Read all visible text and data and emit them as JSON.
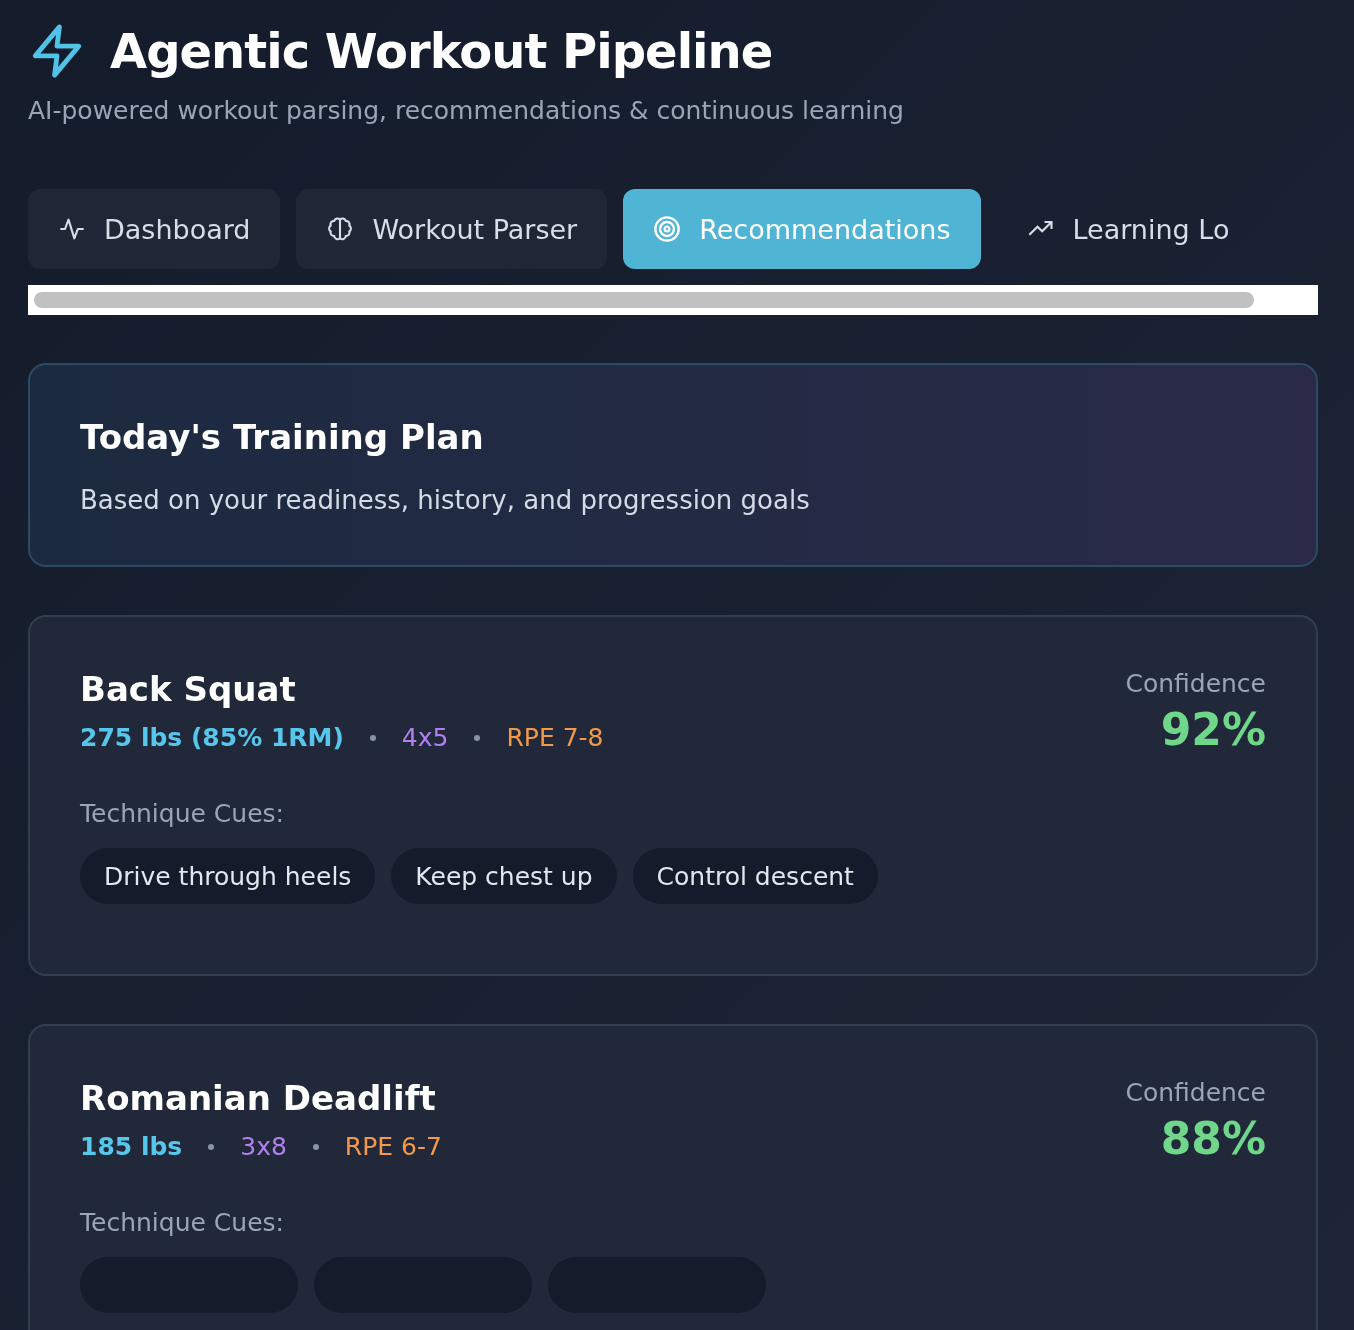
{
  "header": {
    "title": "Agentic Workout Pipeline",
    "subtitle": "AI-powered workout parsing, recommendations & continuous learning"
  },
  "tabs": [
    {
      "label": "Dashboard",
      "selected": false
    },
    {
      "label": "Workout Parser",
      "selected": false
    },
    {
      "label": "Recommendations",
      "selected": true
    },
    {
      "label": "Learning Lo",
      "selected": false
    }
  ],
  "plan": {
    "title": "Today's Training Plan",
    "subtitle": "Based on your readiness, history, and progression goals"
  },
  "exercises": [
    {
      "name": "Back Squat",
      "load": "275 lbs (85% 1RM)",
      "scheme": "4x5",
      "rpe": "RPE 7-8",
      "confidence_label": "Confidence",
      "confidence": "92%",
      "cues_label": "Technique Cues:",
      "cues": [
        {
          "kind": "text",
          "text": "Drive through heels"
        },
        {
          "kind": "text",
          "text": "Keep chest up"
        },
        {
          "kind": "text",
          "text": "Control descent"
        }
      ]
    },
    {
      "name": "Romanian Deadlift",
      "load": "185 lbs",
      "scheme": "3x8",
      "rpe": "RPE 6-7",
      "confidence_label": "Confidence",
      "confidence": "88%",
      "cues_label": "Technique Cues:",
      "cues": [
        {
          "kind": "hidden"
        },
        {
          "kind": "hidden"
        },
        {
          "kind": "hidden"
        }
      ]
    }
  ]
}
